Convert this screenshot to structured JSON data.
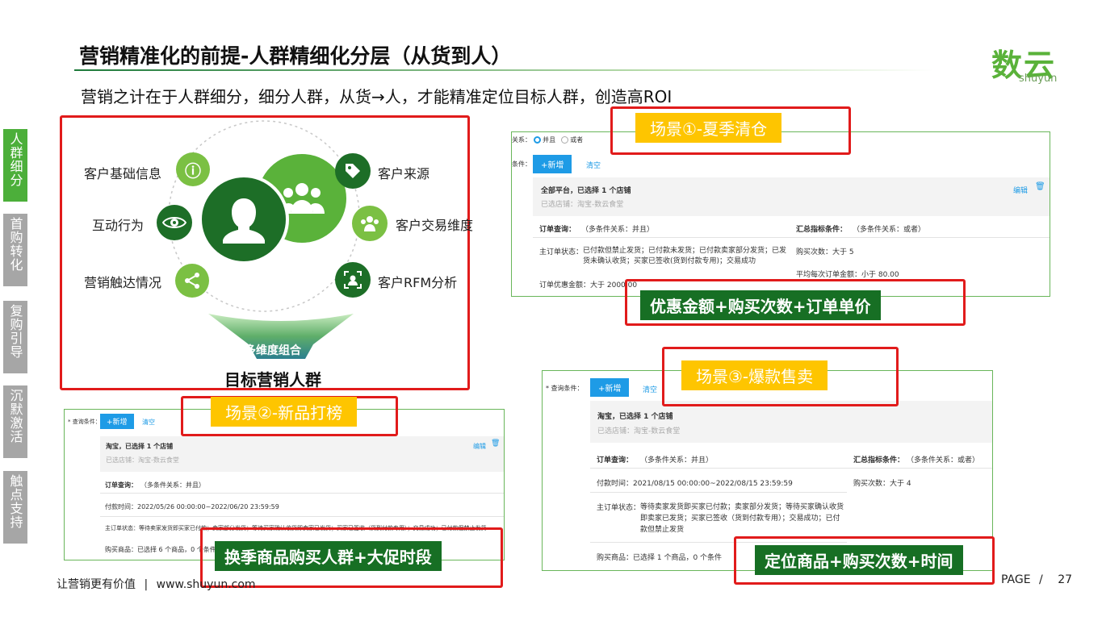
{
  "title": "营销精准化的前提-人群精细化分层（从货到人）",
  "subtitle": "营销之计在于人群细分，细分人群，从货→人，才能精准定位目标人群，创造高ROI",
  "logo": {
    "cn": "数云",
    "en": "shuyun"
  },
  "sidenav": [
    {
      "label": "人群细分",
      "active": true
    },
    {
      "label": "首购转化",
      "active": false
    },
    {
      "label": "复购引导",
      "active": false
    },
    {
      "label": "沉默激活",
      "active": false
    },
    {
      "label": "触点支持",
      "active": false
    }
  ],
  "diagram": {
    "left_nodes": [
      "客户基础信息",
      "互动行为",
      "营销触达情况"
    ],
    "right_nodes": [
      "客户来源",
      "客户交易维度",
      "客户RFM分析"
    ],
    "combine_label": "多维度组合",
    "target_label": "目标营销人群"
  },
  "scene1": {
    "tag": "场景①-夏季清仓",
    "relation_label": "关系：",
    "opt_and": "并且",
    "opt_or": "或者",
    "cond_label": "条件：",
    "add_btn": "+新增",
    "clear_btn": "清空",
    "platform": "全部平台，已选择 1 个店铺",
    "shop": "已选店铺：淘宝-数云食堂",
    "edit": "编辑",
    "order_query": "订单查询：",
    "order_query_note": "（多条件关系：并且）",
    "summary": "汇总指标条件：",
    "summary_note": "（多条件关系：或者）",
    "status_label": "主订单状态：",
    "status_text": "已付款但禁止发货；已付款未发货；已付款卖家部分发货；已发货未确认收货；买家已签收(货到付款专用)；交易成功",
    "buy_count": "购买次数：大于 5",
    "avg_amount": "平均每次订单金额：小于 80.00",
    "discount": "订单优惠金额：大于 2000.00",
    "highlight": "优惠金额+购买次数+订单单价"
  },
  "scene2": {
    "tag": "场景②-新品打榜",
    "cond_label": "* 查询条件：",
    "add_btn": "+新增",
    "clear_btn": "清空",
    "platform": "淘宝，已选择 1 个店铺",
    "shop": "已选店铺：淘宝-数云食堂",
    "edit": "编辑",
    "order_query": "订单查询：",
    "order_query_note": "（多条件关系：并且）",
    "pay_time": "付款时间：2022/05/26 00:00:00~2022/06/20 23:59:59",
    "status": "主订单状态：等待卖家发货即买家已付款；卖家部分发货；等待买家确认收货即卖家已发货；买家已签收（货到付款专用）；交易成功；已付款但禁止发货",
    "goods": "购买商品：已选择 6 个商品，0 个条件",
    "highlight": "换季商品购买人群+大促时段"
  },
  "scene3": {
    "tag": "场景③-爆款售卖",
    "cond_label": "* 查询条件：",
    "add_btn": "+新增",
    "clear_btn": "清空",
    "platform": "淘宝，已选择 1 个店铺",
    "shop": "已选店铺：淘宝-数云食堂",
    "order_query": "订单查询：",
    "order_query_note": "（多条件关系：并且）",
    "summary": "汇总指标条件：",
    "summary_note": "（多条件关系：或者）",
    "pay_time": "付款时间：2021/08/15 00:00:00~2022/08/15 23:59:59",
    "buy_count": "购买次数：大于 4",
    "status_label": "主订单状态：",
    "status_text": "等待卖家发货即买家已付款；卖家部分发货；等待买家确认收货即卖家已发货；买家已签收（货到付款专用）；交易成功；已付款但禁止发货",
    "goods": "购买商品：已选择 1 个商品，0 个条件",
    "highlight": "定位商品+购买次数+时间"
  },
  "footer": {
    "slogan": "让营销更有价值",
    "sep": "|",
    "url": "www.shuyun.com",
    "page_label": "PAGE",
    "slash": "/",
    "page_num": "27"
  },
  "colors": {
    "green": "#176f24",
    "light_green": "#4caf3a",
    "yellow": "#fec500",
    "red": "#e11b1b",
    "blue": "#1e9be6"
  }
}
